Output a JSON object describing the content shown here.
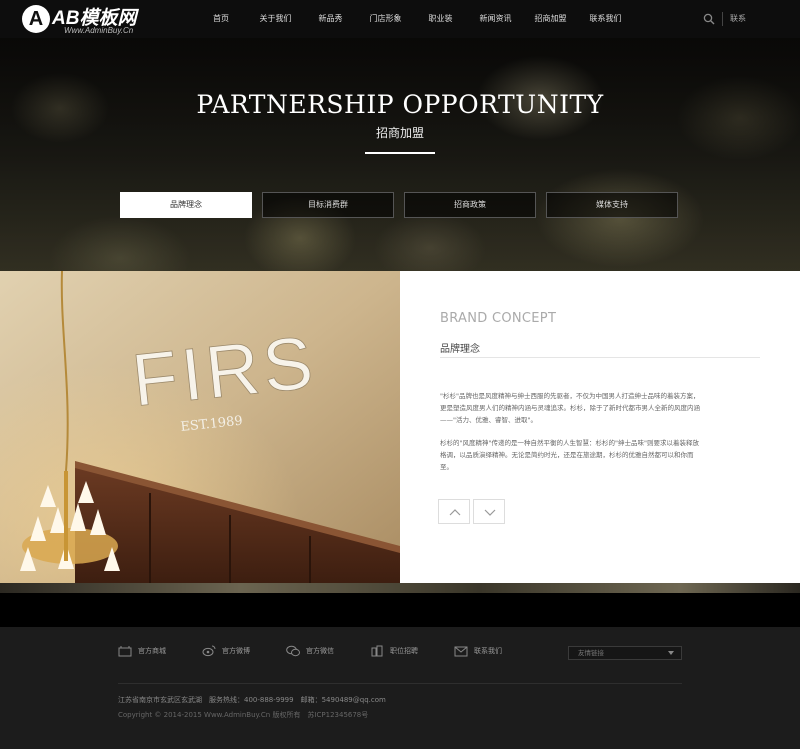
{
  "header": {
    "logo_text": "AB模板网",
    "logo_url": "Www.AdminBuy.Cn",
    "nav": [
      "首页",
      "关于我们",
      "新品秀",
      "门店形象",
      "职业装",
      "新闻资讯",
      "招商加盟",
      "联系我们"
    ],
    "lang": "联系",
    "search_icon": "search-icon"
  },
  "banner": {
    "title_en": "PARTNERSHIP OPPORTUNITY",
    "title_cn": "招商加盟",
    "tabs": [
      "品牌理念",
      "目标消费群",
      "招商政策",
      "媒体支持"
    ],
    "active_tab": 0
  },
  "photo": {
    "sign": "FIRS",
    "est": "EST.1989"
  },
  "content": {
    "title_en": "BRAND CONCEPT",
    "title_cn": "品牌理念",
    "para1": "\"杉杉\"品牌也是风度精神与绅士西服的先驱者，不仅为中国男人打造绅士品味的着装方案，更是塑造风度男人们的精神内涵与灵魂追求。杉杉，除于了新时代都市男人全新的风度内涵——\"活力、优雅、睿智、进取\"。",
    "para2": "杉杉的\"风度精神\"传递的是一种自然平衡的人生智慧：杉杉的\"绅士品味\"则要求以着装释放格调，以品质演绎精神。无论是简约时光，还是在旅途期，杉杉的优雅自然都可以和你而至。",
    "up_icon": "chevron-up-icon",
    "down_icon": "chevron-down-icon"
  },
  "footer": {
    "links": [
      {
        "label": "官方商城",
        "icon": "tmall-icon"
      },
      {
        "label": "官方微博",
        "icon": "weibo-icon"
      },
      {
        "label": "官方微信",
        "icon": "wechat-icon"
      },
      {
        "label": "职位招聘",
        "icon": "building-icon"
      },
      {
        "label": "联系我们",
        "icon": "mail-icon"
      }
    ],
    "select_placeholder": "友情链接",
    "address": "江苏省南京市玄武区玄武湖　服务热线：400-888-9999　邮箱：5490489@qq.com",
    "copyright": "Copyright © 2014-2015 Www.AdminBuy.Cn 版权所有　苏ICP12345678号"
  }
}
